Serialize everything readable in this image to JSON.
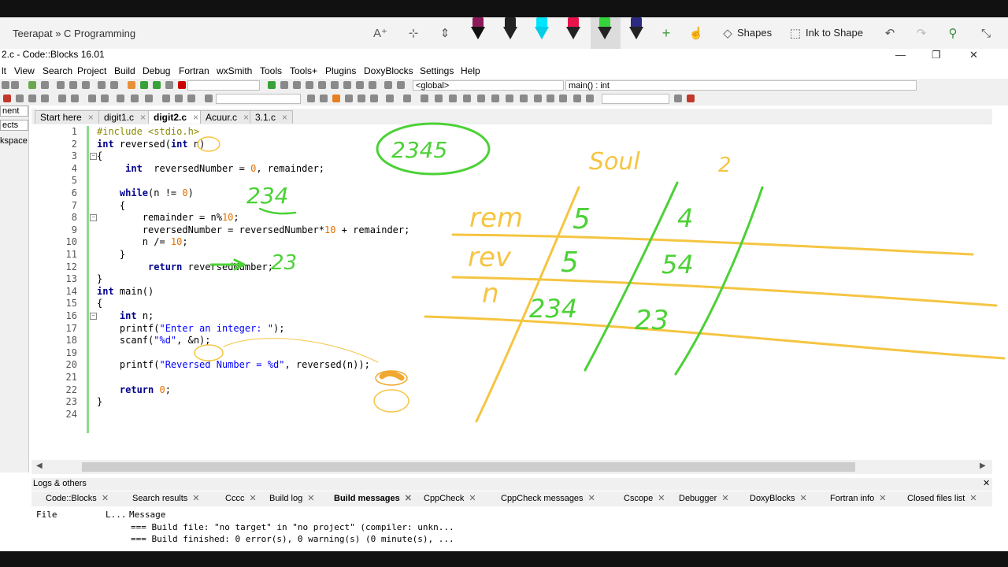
{
  "ribbon": {
    "notebook_path": "Teerapat » C Programming",
    "shapes_label": "Shapes",
    "ink_to_shape_label": "Ink to Shape",
    "pen_colors": [
      "#8b1a5a",
      "#222222",
      "#00e5ff",
      "#e8134b",
      "#35d43a",
      "#2a2a80"
    ]
  },
  "window": {
    "title": "2.c - Code::Blocks 16.01"
  },
  "menu": [
    "lt",
    "View",
    "Search",
    "Project",
    "Build",
    "Debug",
    "Fortran",
    "wxSmith",
    "Tools",
    "Tools+",
    "Plugins",
    "DoxyBlocks",
    "Settings",
    "Help"
  ],
  "toolbar": {
    "scope_combo": "<global>",
    "function_combo": "main() : int"
  },
  "left_panel": {
    "tabs": [
      "nent",
      "ects",
      "kspace"
    ]
  },
  "editor_tabs": [
    {
      "label": "Start here",
      "active": false
    },
    {
      "label": "digit1.c",
      "active": false
    },
    {
      "label": "digit2.c",
      "active": true
    },
    {
      "label": "Acuur.c",
      "active": false
    },
    {
      "label": "3.1.c",
      "active": false
    }
  ],
  "code_lines": [
    "#include <stdio.h>",
    "int reversed(int n)",
    "{",
    "     int  reversedNumber = 0, remainder;",
    "",
    "    while(n != 0)",
    "    {",
    "        remainder = n%10;",
    "        reversedNumber = reversedNumber*10 + remainder;",
    "        n /= 10;",
    "    }",
    "         return reversedNumber;",
    "}",
    "int main()",
    "{",
    "    int n;",
    "    printf(\"Enter an integer: \");",
    "    scanf(\"%d\", &n);",
    "",
    "    printf(\"Reversed Number = %d\", reversed(n));",
    "",
    "    return 0;",
    "}",
    ""
  ],
  "logs": {
    "title": "Logs & others",
    "tabs": [
      "Code::Blocks",
      "Search results",
      "Cccc",
      "Build log",
      "Build messages",
      "CppCheck",
      "CppCheck messages",
      "Cscope",
      "Debugger",
      "DoxyBlocks",
      "Fortran info",
      "Closed files list"
    ],
    "active_tab": "Build messages",
    "col_file": "File",
    "col_line": "L...",
    "col_message": "Message",
    "messages": [
      "=== Build file: \"no target\" in \"no project\" (compiler: unkn...",
      "=== Build finished: 0 error(s), 0 warning(s) (0 minute(s), ..."
    ]
  },
  "handwriting": {
    "circled": "2345",
    "soul": "Soul",
    "top_number": "2",
    "n1": "234",
    "n2": "23",
    "rem_label": "rem",
    "rev_label": "rev",
    "n_label": "n",
    "rem_vals": [
      "5",
      "4"
    ],
    "rev_vals": [
      "5",
      "54"
    ],
    "n_vals": [
      "234",
      "23"
    ],
    "colors": {
      "green": "#4cd137",
      "yellow": "#f5c542",
      "orange": "#f0a830"
    }
  }
}
